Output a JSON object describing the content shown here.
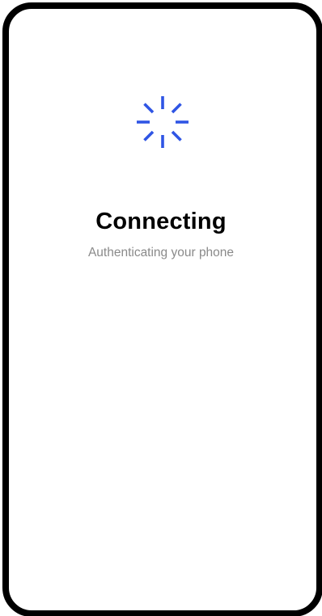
{
  "screen": {
    "title": "Connecting",
    "subtitle": "Authenticating your phone",
    "spinner_icon": "loading-spinner-icon"
  },
  "colors": {
    "accent": "#2f55e4",
    "frame": "#000000",
    "background": "#ffffff",
    "subtitle": "#8a8a8a"
  }
}
